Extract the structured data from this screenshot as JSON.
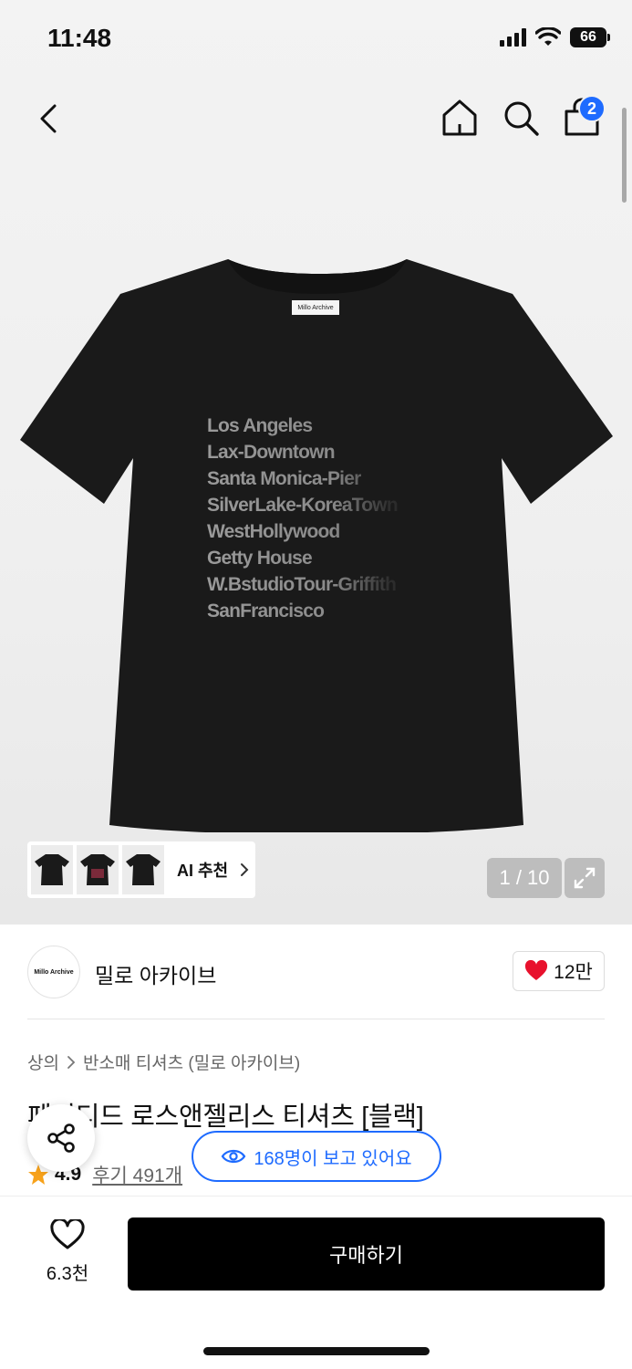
{
  "status_bar": {
    "time": "11:48",
    "battery": "66"
  },
  "nav": {
    "cart_count": "2"
  },
  "product_image": {
    "label_text": "Millo Archive",
    "print_lines": [
      "Los Angeles",
      "Lax-Downtown",
      "Santa Monica-Pier",
      "SilverLake-KoreaTown",
      "WestHollywood",
      "Getty House",
      "W.BstudioTour-Griffith",
      "SanFrancisco"
    ],
    "ai_recommend_label": "AI 추천",
    "pager": "1 / 10"
  },
  "brand": {
    "logo_text": "Millo Archive",
    "name": "밀로 아카이브",
    "like_count": "12만"
  },
  "breadcrumb": {
    "level1": "상의",
    "level2": "반소매 티셔츠 (밀로 아카이브)"
  },
  "product": {
    "title": "페이디드 로스앤젤리스 티셔츠 [블랙]",
    "rating": "4.9",
    "reviews": "후기 491개"
  },
  "viewers_text": "168명이 보고 있어요",
  "bottom_bar": {
    "wish_count": "6.3천",
    "buy_label": "구매하기"
  },
  "colors": {
    "accent_blue": "#1e6bff",
    "heart_red": "#e8112d",
    "star_orange": "#f7a21b",
    "buy_button": "#000000"
  }
}
